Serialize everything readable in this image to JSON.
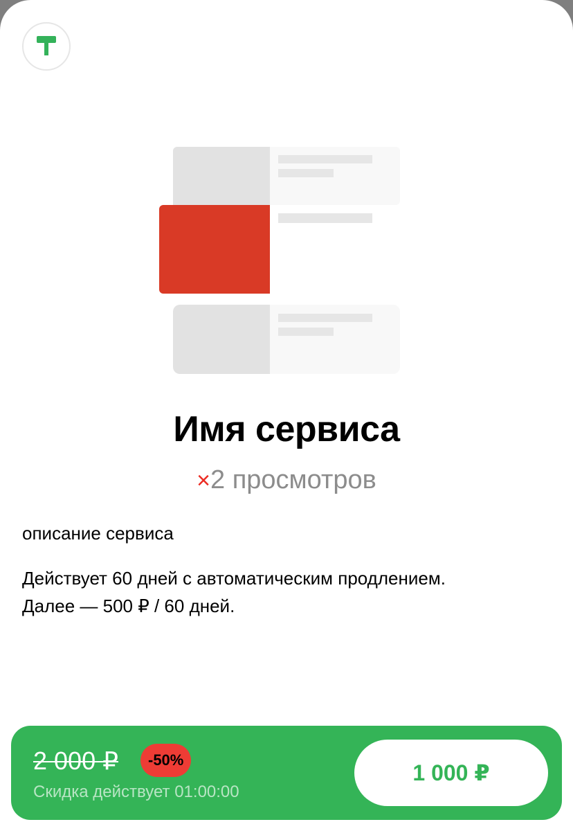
{
  "service": {
    "title": "Имя сервиса",
    "multiplier_sign": "×",
    "multiplier_text": "2 просмотров",
    "description": "описание сервиса",
    "terms_line1": "Действует 60 дней с автоматическим продлением.",
    "terms_line2": "Далее — 500 ₽ / 60 дней."
  },
  "offer": {
    "old_price": "2 000 ₽",
    "discount_badge": "-50%",
    "timer_text": "Скидка действует 01:00:00",
    "buy_label": "1 000 ₽"
  },
  "colors": {
    "brand_green": "#34b457",
    "accent_red": "#d93a26",
    "badge_red": "#ee3c35",
    "placeholder_gray": "#e2e2e2",
    "placeholder_light": "#f8f8f8"
  },
  "icons": {
    "logo": "green-t-logo-icon"
  }
}
